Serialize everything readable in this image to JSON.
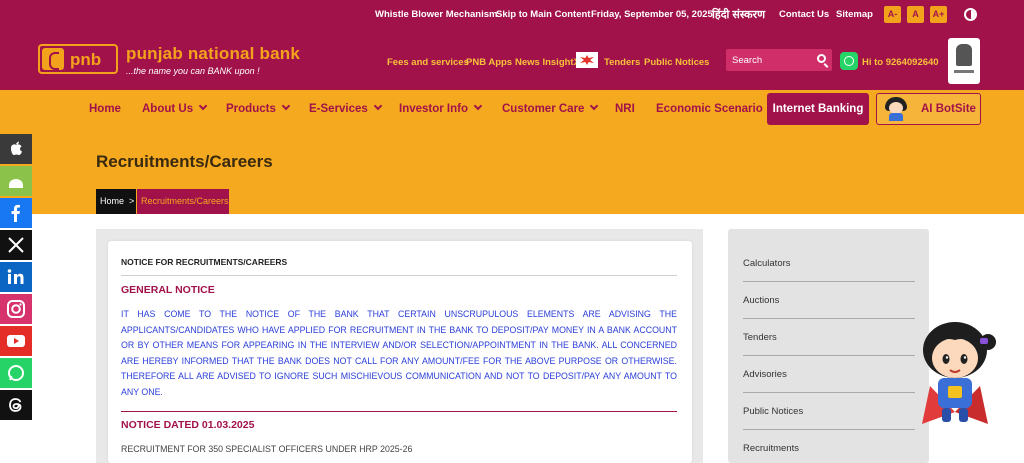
{
  "topbar": {
    "whistle": "Whistle Blower Mechanism",
    "skip": "Skip to Main Content",
    "date": "Friday, September 05, 2025",
    "hindi": "हिंदी संस्करण",
    "contact": "Contact Us",
    "sitemap": "Sitemap",
    "font_small": "A-",
    "font_normal": "A",
    "font_large": "A+"
  },
  "header": {
    "logo_text": "pnb",
    "bank_name": "punjab national bank",
    "tagline": "...the name you can BANK upon !",
    "links": [
      "Fees and services",
      "PNB Apps",
      "News InsightX",
      "Tenders",
      "Public Notices"
    ],
    "search_placeholder": "Search",
    "whatsapp_text": "Hi to 9264092640"
  },
  "nav": {
    "items": [
      "Home",
      "About Us",
      "Products",
      "E-Services",
      "Investor Info",
      "Customer Care",
      "NRI",
      "Economic Scenario"
    ],
    "internet_banking": "Internet Banking",
    "bot": "AI BotSite"
  },
  "page": {
    "title": "Recruitments/Careers",
    "breadcrumb_home": "Home",
    "breadcrumb_sep": ">",
    "breadcrumb_current": "Recruitments/Careers"
  },
  "notice": {
    "card_title": "NOTICE FOR RECRUITMENTS/CAREERS",
    "general_heading": "GENERAL NOTICE",
    "general_body": "IT HAS COME TO THE NOTICE OF THE BANK THAT CERTAIN UNSCRUPULOUS ELEMENTS ARE ADVISING THE APPLICANTS/CANDIDATES WHO HAVE APPLIED FOR RECRUITMENT IN THE BANK TO DEPOSIT/PAY MONEY IN A BANK ACCOUNT OR BY OTHER MEANS FOR APPEARING IN THE INTERVIEW AND/OR SELECTION/APPOINTMENT IN THE BANK. ALL CONCERNED ARE HEREBY INFORMED THAT THE BANK DOES NOT CALL FOR ANY AMOUNT/FEE FOR THE ABOVE PURPOSE OR OTHERWISE. THEREFORE ALL ARE ADVISED TO IGNORE SUCH MISCHIEVOUS COMMUNICATION AND NOT TO DEPOSIT/PAY ANY AMOUNT TO ANY ONE.",
    "dated_heading": "NOTICE DATED 01.03.2025",
    "dated_item": "RECRUITMENT FOR 350 SPECIALIST OFFICERS UNDER HRP 2025-26"
  },
  "sidebar": {
    "items": [
      "Calculators",
      "Auctions",
      "Tenders",
      "Advisories",
      "Public Notices",
      "Recruitments"
    ]
  },
  "social": {
    "icons": [
      "apple-icon",
      "android-icon",
      "facebook-icon",
      "x-icon",
      "linkedin-icon",
      "instagram-icon",
      "youtube-icon",
      "whatsapp-icon",
      "threads-icon"
    ],
    "colors": [
      "#3a3a3a",
      "#8bc34a",
      "#1877f2",
      "#111111",
      "#0a66c2",
      "#d6336c",
      "#e52d27",
      "#25d366",
      "#111111"
    ]
  },
  "colors": {
    "brand": "#a2124a",
    "accent": "#f4a91e",
    "notice_text": "#2a3ed8"
  }
}
